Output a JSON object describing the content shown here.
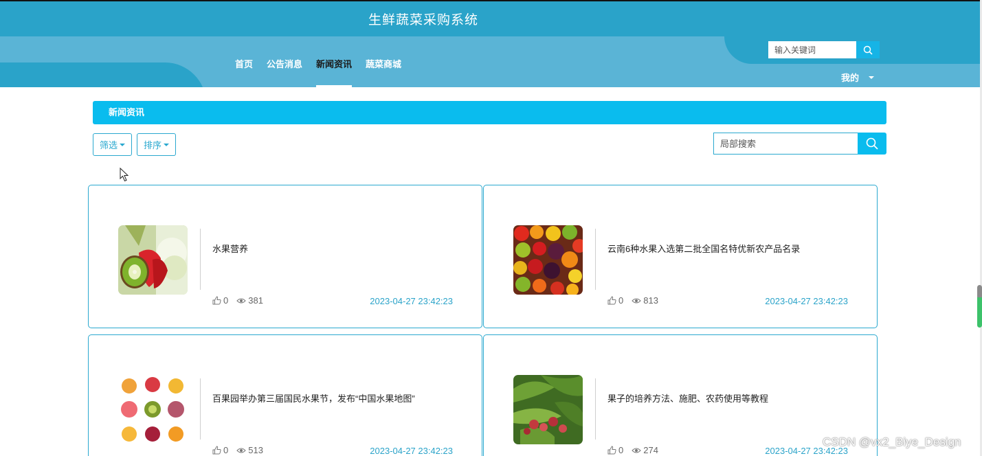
{
  "header": {
    "site_title": "生鲜蔬菜采购系统",
    "nav": [
      {
        "label": "首页",
        "active": false
      },
      {
        "label": "公告消息",
        "active": false
      },
      {
        "label": "新闻资讯",
        "active": true
      },
      {
        "label": "蔬菜商城",
        "active": false
      }
    ],
    "search_placeholder": "输入关键词",
    "user_menu": "我的"
  },
  "section": {
    "title": "新闻资讯"
  },
  "toolbar": {
    "filter_label": "筛选",
    "sort_label": "排序",
    "search_placeholder": "局部搜索"
  },
  "cards": [
    {
      "title": "水果营养",
      "likes": "0",
      "views": "381",
      "date": "2023-04-27 23:42:23",
      "image": "kiwi-strawberry-apple"
    },
    {
      "title": "云南6种水果入选第二批全国名特优新农产品名录",
      "likes": "0",
      "views": "813",
      "date": "2023-04-27 23:42:23",
      "image": "mixed-fruit-pile"
    },
    {
      "title": "百果园举办第三届国民水果节，发布“中国水果地图”",
      "likes": "0",
      "views": "513",
      "date": "2023-04-27 23:42:23",
      "image": "fruit-grid"
    },
    {
      "title": "果子的培养方法、施肥、农药使用等教程",
      "likes": "0",
      "views": "274",
      "date": "2023-04-27 23:42:23",
      "image": "fruit-tree"
    }
  ],
  "watermark": "CSDN @vx2_Biye_Design",
  "colors": {
    "primary": "#2aa3c9",
    "accent": "#0abcee",
    "band": "#5ab4d6"
  }
}
